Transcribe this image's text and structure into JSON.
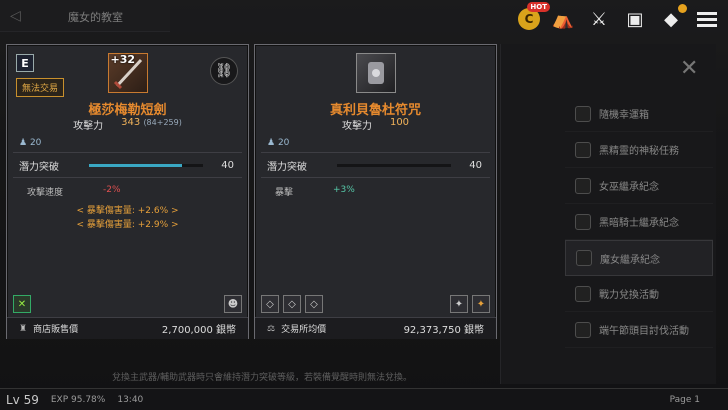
{
  "background": {
    "title": "魔女的教室",
    "side_items": [
      "隨機幸運箱",
      "黑精靈的神秘任務",
      "女巫繼承紀念",
      "黑暗騎士繼承紀念",
      "魔女繼承紀念",
      "戰力兌換活動",
      "端午節頭目討伐活動"
    ],
    "tip": "兌換主武器/輔助武器時只會維持潛力突破等級，若裝備覺醒時則無法兌換。",
    "level": "Lv 59",
    "exp": "EXP 95.78%",
    "time": "13:40",
    "page": "Page 1"
  },
  "topicons": {
    "coin_letter": "C",
    "hot_label": "HOT"
  },
  "left_card": {
    "grade": "E",
    "notrade": "無法交易",
    "enhance": "+32",
    "name": "極莎梅勒短劍",
    "attack_label": "攻擊力",
    "attack_value": "343",
    "attack_sub": "(84+259)",
    "req_level": "20",
    "potential_label": "潛力突破",
    "potential_value": "40",
    "potential_fill": 0.82,
    "stat_label": "攻擊速度",
    "stat_value": "-2%",
    "crit1": "< 暴擊傷害量: +2.6% >",
    "crit2": "< 暴擊傷害量: +2.9% >",
    "price_label": "商店販售價",
    "price_value": "2,700,000 銀幣"
  },
  "right_card": {
    "name": "真利貝魯杜符咒",
    "attack_label": "攻擊力",
    "attack_value": "100",
    "req_level": "20",
    "potential_label": "潛力突破",
    "potential_value": "40",
    "potential_fill": 0.0,
    "stat_label": "暴擊",
    "stat_value": "+3%",
    "price_label": "交易所均價",
    "price_value": "92,373,750 銀幣"
  },
  "colors": {
    "accent_orange": "#e68a2e",
    "potential_bar": "#3aa8c4"
  }
}
